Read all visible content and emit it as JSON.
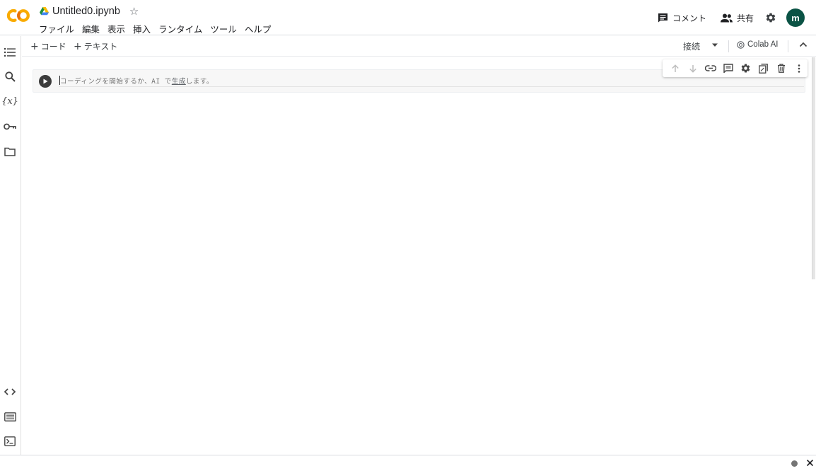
{
  "header": {
    "doc_title": "Untitled0.ipynb",
    "menu": [
      "ファイル",
      "編集",
      "表示",
      "挿入",
      "ランタイム",
      "ツール",
      "ヘルプ"
    ],
    "comment_label": "コメント",
    "share_label": "共有",
    "avatar_letter": "m",
    "avatar_color": "#0b5345"
  },
  "toolbar": {
    "add_code_label": "コード",
    "add_text_label": "テキスト",
    "connect_label": "接続",
    "colab_ai_label": "Colab AI"
  },
  "cell": {
    "placeholder_before": "コーディングを開始するか、AI で",
    "placeholder_link": "生成",
    "placeholder_after": "します。"
  },
  "icons": {
    "rail_top": [
      "toc-icon",
      "search-icon",
      "variables-icon",
      "key-icon",
      "folder-icon"
    ],
    "rail_bottom": [
      "code-icon",
      "command-palette-icon",
      "terminal-icon"
    ],
    "cell_tools": [
      "arrow-up-icon",
      "arrow-down-icon",
      "link-icon",
      "comment-icon",
      "gear-icon",
      "mirror-cell-icon",
      "trash-icon",
      "more-vert-icon"
    ]
  },
  "colors": {
    "logo_orange": "#f9ab00",
    "logo_dark_orange": "#e8710a",
    "avatar_bg": "#0b5345"
  }
}
